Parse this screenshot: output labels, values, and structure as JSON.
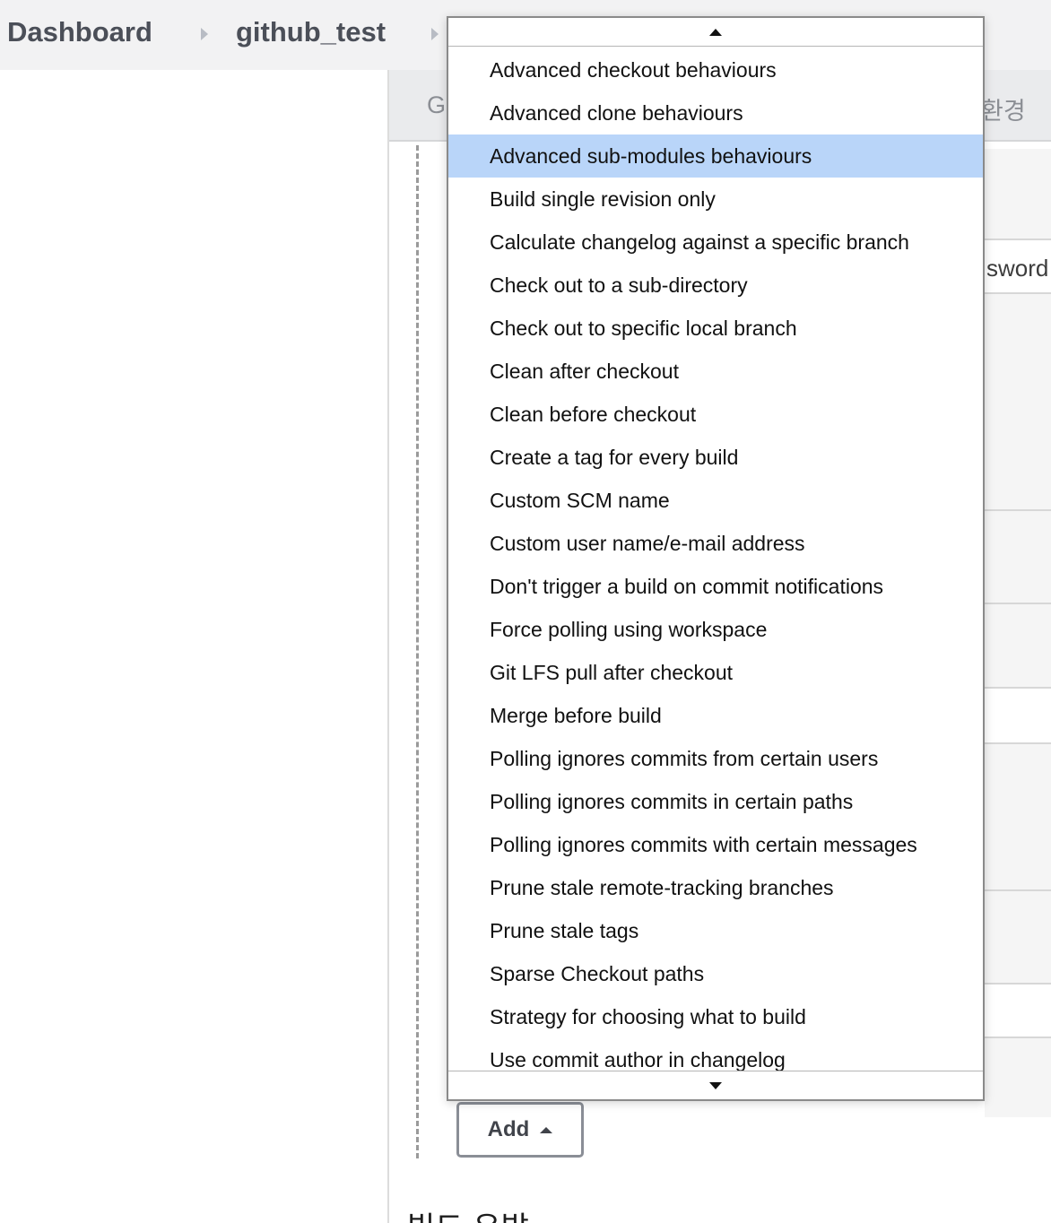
{
  "breadcrumb": {
    "items": [
      "Dashboard",
      "github_test"
    ]
  },
  "tabs": {
    "left_fragment": "G",
    "right_fragment": "환경"
  },
  "form": {
    "password_fragment": "sword",
    "add_button_label": "Add"
  },
  "section": {
    "heading_fragment": "빌드 유발"
  },
  "dropdown": {
    "selected_index": 2,
    "options": [
      "Advanced checkout behaviours",
      "Advanced clone behaviours",
      "Advanced sub-modules behaviours",
      "Build single revision only",
      "Calculate changelog against a specific branch",
      "Check out to a sub-directory",
      "Check out to specific local branch",
      "Clean after checkout",
      "Clean before checkout",
      "Create a tag for every build",
      "Custom SCM name",
      "Custom user name/e-mail address",
      "Don't trigger a build on commit notifications",
      "Force polling using workspace",
      "Git LFS pull after checkout",
      "Merge before build",
      "Polling ignores commits from certain users",
      "Polling ignores commits in certain paths",
      "Polling ignores commits with certain messages",
      "Prune stale remote-tracking branches",
      "Prune stale tags",
      "Sparse Checkout paths",
      "Strategy for choosing what to build",
      "Use commit author in changelog"
    ]
  },
  "colors": {
    "selected_option_bg": "#b9d5f9",
    "breadcrumb_bg": "#f2f2f3",
    "tabbar_bg": "#eaebed"
  }
}
